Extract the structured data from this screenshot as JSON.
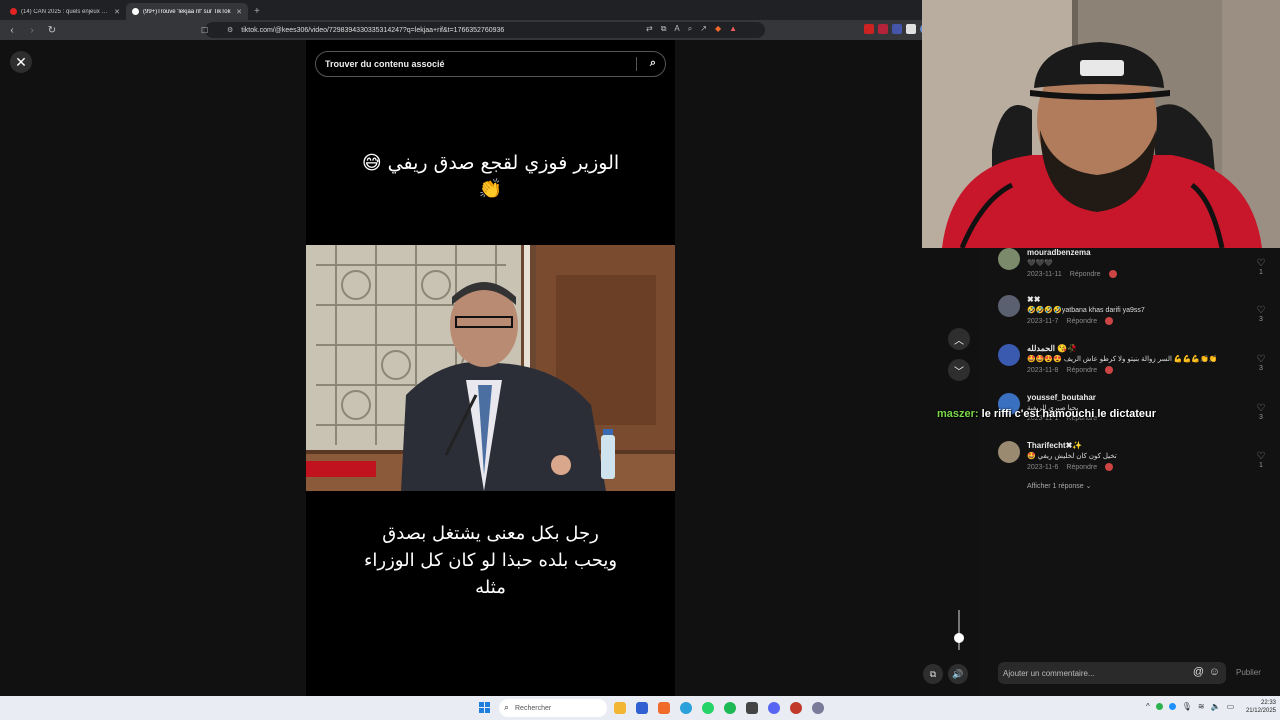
{
  "browser": {
    "tabs": [
      {
        "title": "(14) CAN 2025 : quels enjeux pour le",
        "active": false,
        "favicon_color": "#e02424"
      },
      {
        "title": "(99+)Trouve 'lekjaa rif' sur TikTok",
        "active": true,
        "favicon_color": "#ffffff"
      }
    ],
    "url": "tiktok.com/@kees306/video/7298394330335314247?q=lekjaa+rif&t=1766352760936"
  },
  "tiktok": {
    "search_placeholder": "Trouver du contenu associé",
    "caption_top_line1": "الوزير فوزي لقجع صدق ريفي 😅",
    "caption_top_line2": "👏",
    "caption_bottom_line1": "رجل بكل معنى يشتغل بصدق",
    "caption_bottom_line2": "ويحب بلده حبذا لو كان كل الوزراء",
    "caption_bottom_line3": "مثله",
    "comments": [
      {
        "user": "mouradbenzema",
        "text": "🖤🖤🖤",
        "date": "2023-11-11",
        "reply": "Répondre",
        "likes": "1",
        "avatar": "#7a8a6a"
      },
      {
        "user": "✖✖",
        "text": "🤣🤣🤣🤣yatbana khas darifi ya9ss7",
        "date": "2023-11-7",
        "reply": "Répondre",
        "likes": "3",
        "avatar": "#5a6070"
      },
      {
        "user": "الحمدلله 😘🥀",
        "text": "🤩🤩😍😍 السر زوالة بنيتو ولا كرطو عاش الريف 💪💪💪👏👏",
        "date": "2023-11-8",
        "reply": "Répondre",
        "likes": "3",
        "avatar": "#3a5ab0"
      },
      {
        "user": "youssef_boutahar",
        "text": "يحيا صبري الريفية",
        "date": "2023-11-1",
        "reply": "Répondre",
        "likes": "3",
        "avatar": "#3a70c0"
      },
      {
        "user": "Tharifecht✖✨",
        "text": "🤩 تخيل كون كان لخليش ريفي",
        "date": "2023-11-6",
        "reply": "Répondre",
        "likes": "1",
        "avatar": "#9a8a70"
      }
    ],
    "show_replies": "Afficher 1 réponse",
    "comment_placeholder": "Ajouter un commentaire...",
    "publish_label": "Publier"
  },
  "stream_chat": {
    "user": "maszer:",
    "message": "le riffi c'est hamouchi le dictateur"
  },
  "taskbar": {
    "search_label": "Rechercher",
    "time": "22:33",
    "date": "21/12/2025"
  }
}
